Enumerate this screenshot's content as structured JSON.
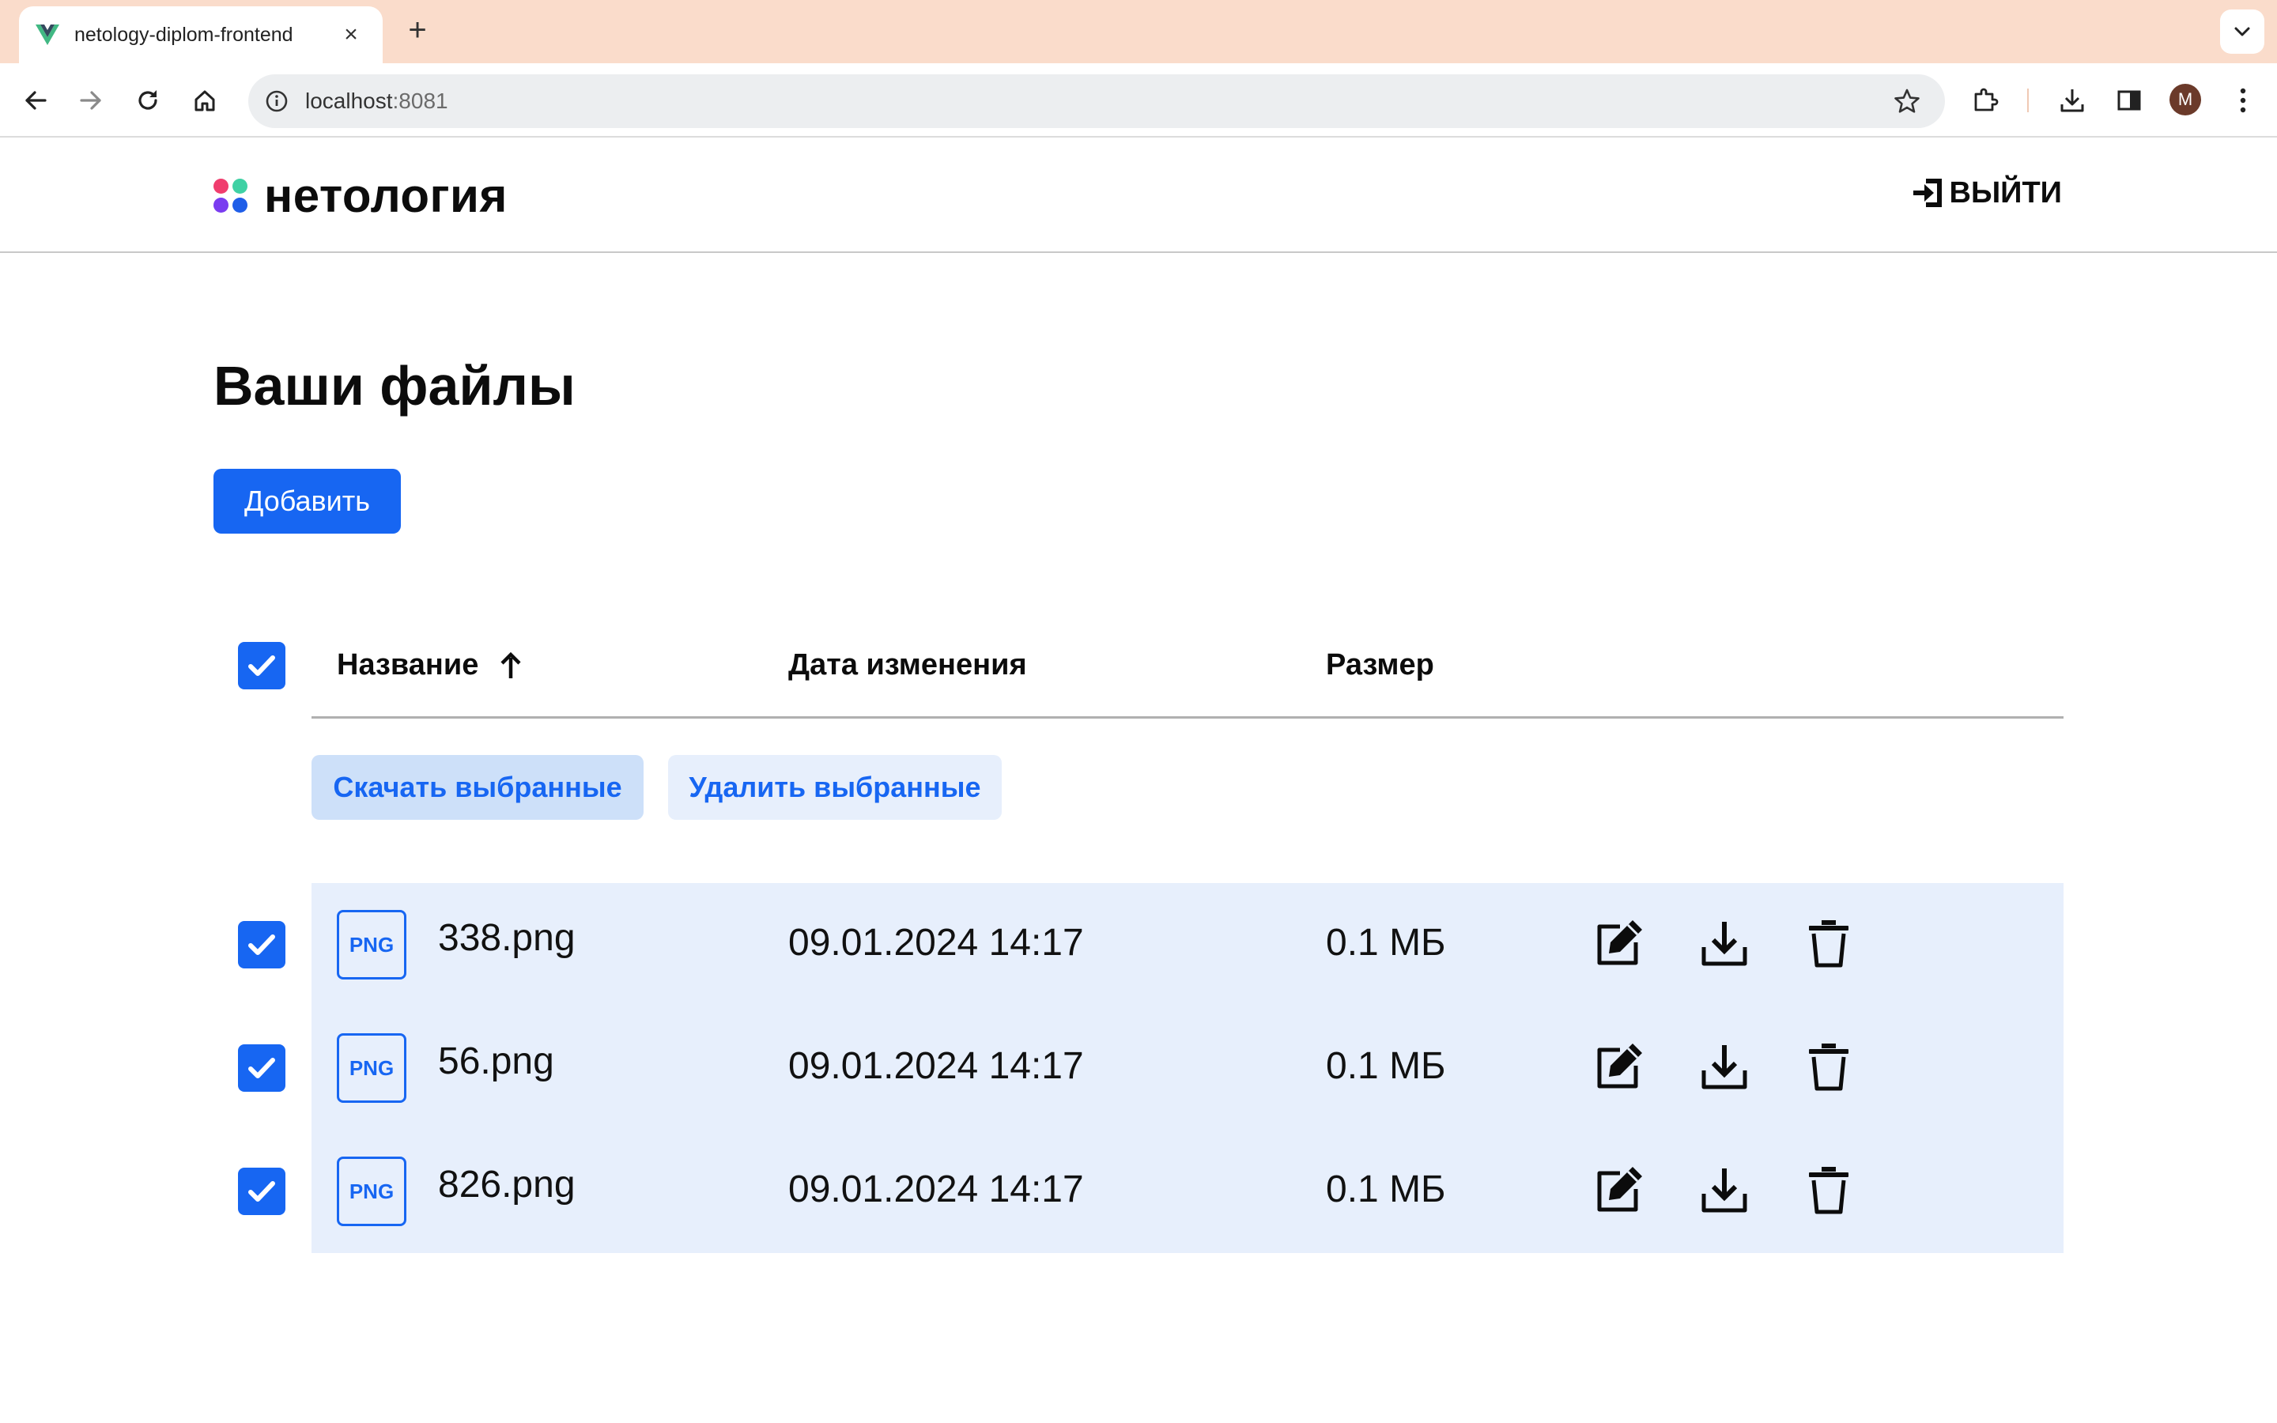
{
  "browser": {
    "tab_title": "netology-diplom-frontend",
    "new_tab_label": "+",
    "close_label": "×",
    "url_host": "localhost",
    "url_port": ":8081",
    "avatar_initial": "M"
  },
  "header": {
    "logo_text": "нетология",
    "logout_label": "ВЫЙТИ"
  },
  "page": {
    "title": "Ваши файлы",
    "add_button": "Добавить"
  },
  "table": {
    "columns": {
      "name": "Название",
      "modified": "Дата изменения",
      "size": "Размер"
    },
    "sort": {
      "column": "name",
      "direction": "ascending"
    },
    "select_all_checked": true,
    "bulk_download_label": "Скачать выбранные",
    "bulk_delete_label": "Удалить выбранные",
    "rows": [
      {
        "type": "PNG",
        "name": "338.png",
        "modified": "09.01.2024 14:17",
        "size": "0.1 МБ",
        "checked": true
      },
      {
        "type": "PNG",
        "name": "56.png",
        "modified": "09.01.2024 14:17",
        "size": "0.1 МБ",
        "checked": true
      },
      {
        "type": "PNG",
        "name": "826.png",
        "modified": "09.01.2024 14:17",
        "size": "0.1 МБ",
        "checked": true
      }
    ]
  },
  "colors": {
    "accent": "#1766f2",
    "row_background": "#e7effc",
    "bulk_download_background": "#cde0f9",
    "tabstrip": "#fadccb"
  },
  "icons": {
    "edit": "edit-icon",
    "download": "download-icon",
    "delete": "trash-icon",
    "logout": "logout-icon",
    "sort": "arrow-up-icon"
  }
}
